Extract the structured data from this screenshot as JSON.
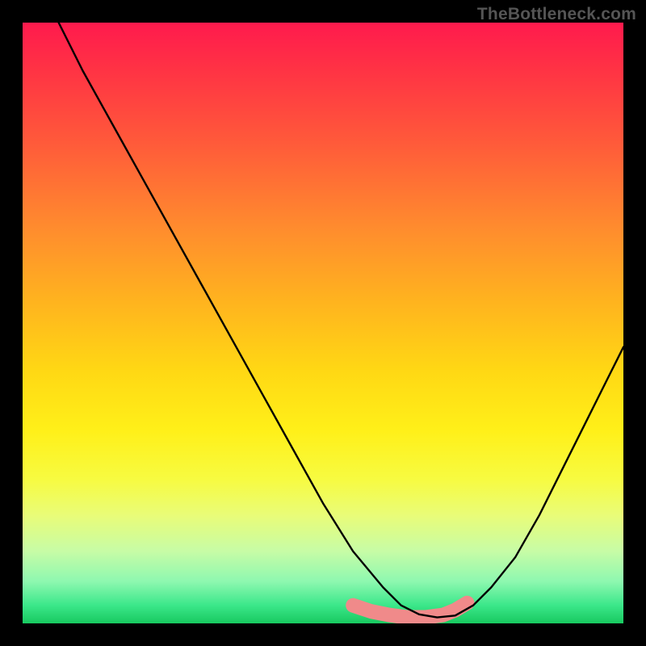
{
  "watermark": "TheBottleneck.com",
  "chart_data": {
    "type": "line",
    "title": "",
    "xlabel": "",
    "ylabel": "",
    "xlim": [
      0,
      100
    ],
    "ylim": [
      0,
      100
    ],
    "grid": false,
    "legend": false,
    "series": [
      {
        "name": "bottleneck-curve",
        "x": [
          6,
          10,
          15,
          20,
          25,
          30,
          35,
          40,
          45,
          50,
          55,
          60,
          63,
          66,
          69,
          72,
          75,
          78,
          82,
          86,
          90,
          94,
          98,
          100
        ],
        "values": [
          100,
          92,
          83,
          74,
          65,
          56,
          47,
          38,
          29,
          20,
          12,
          6,
          3,
          1.5,
          1,
          1.3,
          3,
          6,
          11,
          18,
          26,
          34,
          42,
          46
        ]
      },
      {
        "name": "highlight-valley",
        "x": [
          55,
          58,
          61,
          64,
          67,
          70,
          72,
          74
        ],
        "values": [
          3.0,
          2.0,
          1.4,
          1.0,
          1.0,
          1.4,
          2.2,
          3.4
        ]
      }
    ],
    "colors": {
      "curve": "#000000",
      "highlight": "#f08a8a",
      "gradient_top": "#ff1a4d",
      "gradient_bottom": "#18c95f",
      "frame": "#000000"
    },
    "annotations": []
  }
}
